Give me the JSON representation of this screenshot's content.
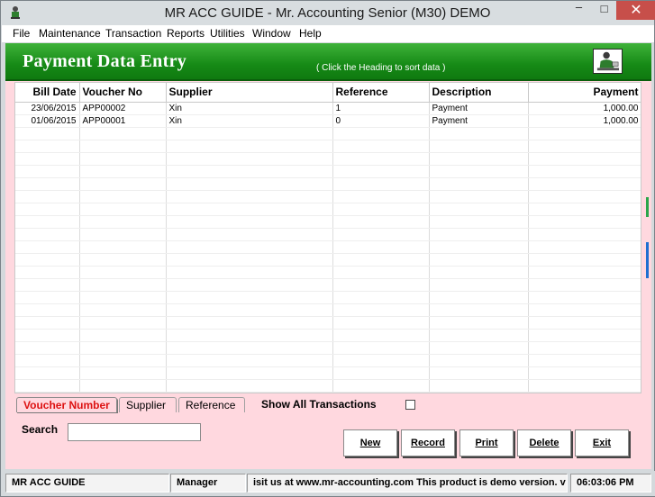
{
  "window": {
    "title": "MR ACC GUIDE - Mr. Accounting Senior (M30) DEMO",
    "minimize": "–",
    "maximize": "□",
    "close": "✕"
  },
  "menu": [
    "File",
    "Maintenance",
    "Transaction",
    "Reports",
    "Utilities",
    "Window",
    "Help"
  ],
  "header": {
    "title": "Payment Data Entry",
    "hint": "( Click the Heading to sort data )",
    "figure_icon": "accountant-figure-icon",
    "accent": "#168a16"
  },
  "grid": {
    "columns": [
      "Bill Date",
      "Voucher No",
      "Supplier",
      "Reference",
      "Description",
      "Payment"
    ],
    "rows": [
      [
        "23/06/2015",
        "APP00002",
        "Xin",
        "1",
        "Payment",
        "1,000.00"
      ],
      [
        "01/06/2015",
        "APP00001",
        "Xin",
        "0",
        "Payment",
        "1,000.00"
      ]
    ]
  },
  "tabs": [
    "Voucher Number",
    "Supplier",
    "Reference"
  ],
  "show_all": "Show All Transactions",
  "search": {
    "label": "Search",
    "value": ""
  },
  "buttons": {
    "new": "New",
    "record": "Record",
    "print": "Print",
    "delete": "Delete",
    "exit": "Exit"
  },
  "status": {
    "app": "MR ACC GUIDE",
    "user": "Manager",
    "message": "isit us at www.mr-accounting.com This product is demo version.  v",
    "time": "06:03:06 PM"
  },
  "colors": {
    "body": "#ffd8df",
    "active_tab": "#dd1111"
  }
}
